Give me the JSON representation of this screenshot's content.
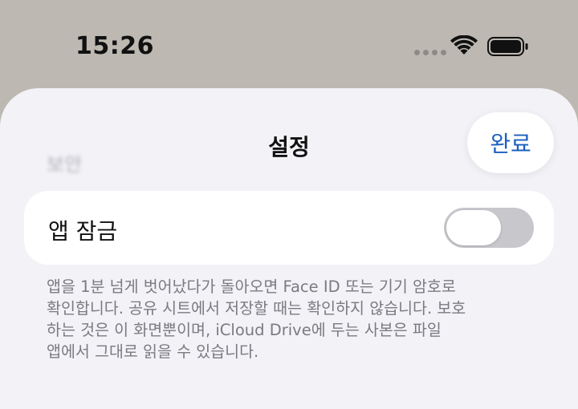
{
  "status_bar": {
    "time": "15:26",
    "wifi_icon": "wifi-icon",
    "battery_icon": "battery-icon"
  },
  "sheet": {
    "ghost_header": "보안",
    "title": "설정",
    "done_label": "완료"
  },
  "app_lock_row": {
    "label": "앱 잠금",
    "toggle_on": false
  },
  "footer": {
    "lines": [
      "앱을 1분 넘게 벗어났다가 돌아오면 Face ID 또는 기기 암호로",
      "확인합니다. 공유 시트에서 저장할 때는 확인하지 않습니다. 보호",
      "하는 것은 이 화면뿐이며, iCloud Drive에 두는 사본은 파일",
      "앱에서 그대로 읽을 수 있습니다."
    ]
  },
  "colors": {
    "background": "#bdb8b1",
    "sheet": "#f2f2f7",
    "accent": "#1a5fbf",
    "toggle_off": "#c7c7cc"
  }
}
